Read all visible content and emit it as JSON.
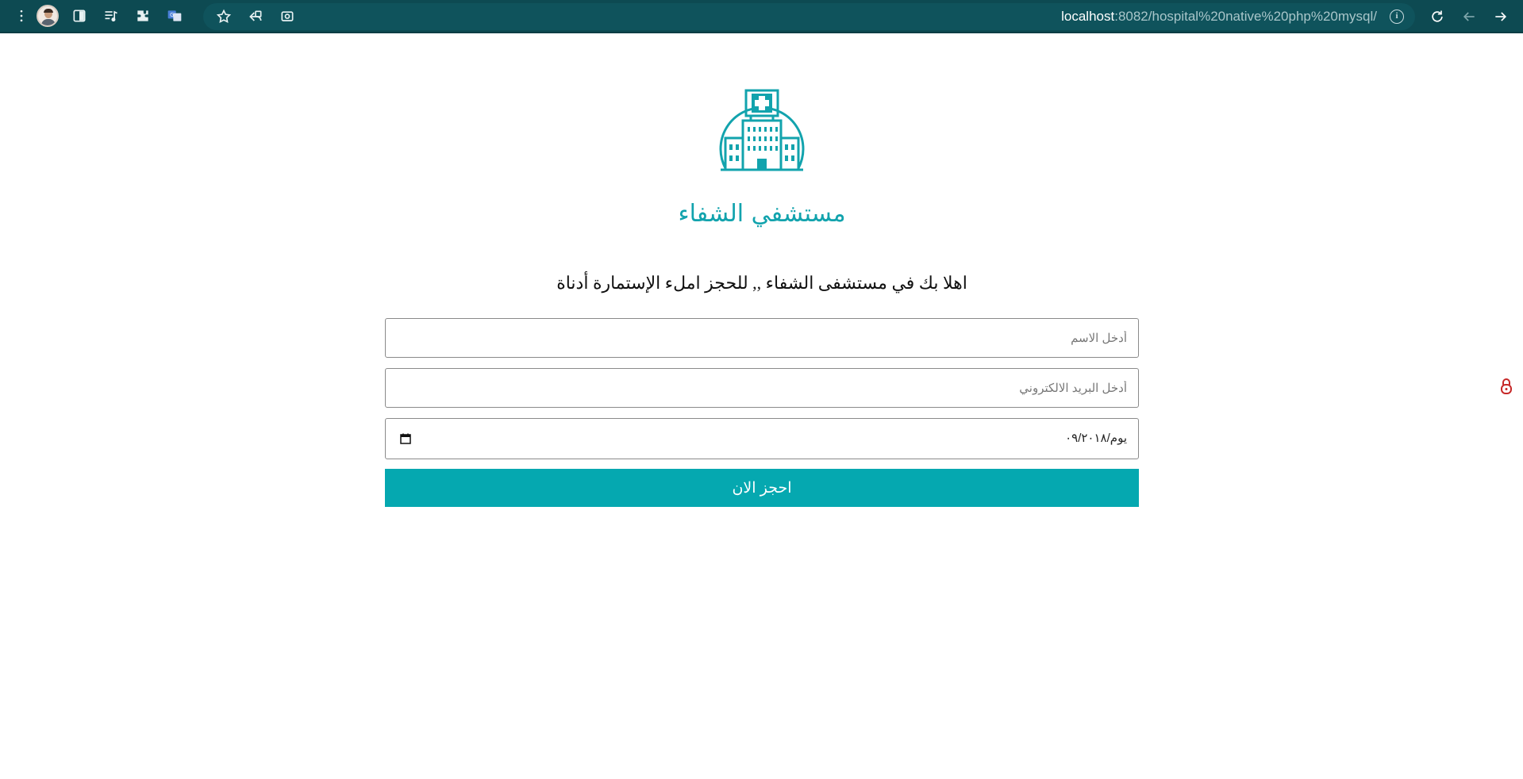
{
  "browser": {
    "url_host": "localhost",
    "url_rest": ":8082/hospital%20native%20php%20mysql/",
    "icons": [
      "menu-dots-icon",
      "profile-avatar",
      "sidebar-icon",
      "media-list-icon",
      "extensions-icon",
      "translate-icon",
      "star-icon",
      "share-icon",
      "screenshot-icon",
      "info-icon",
      "reload-icon",
      "back-icon",
      "forward-icon"
    ]
  },
  "page": {
    "brand_title": "مستشفي الشفاء",
    "welcome_text": "اهلا بك في مستشفى الشفاء ,, للحجز املء الإستمارة أدناة",
    "form": {
      "name_placeholder": "أدخل الاسم",
      "email_placeholder": "أدخل البريد الالكتروني",
      "date_value": "يوم/٠٩/٢٠١٨",
      "submit_label": "احجز الان"
    },
    "colors": {
      "accent": "#05a8b0",
      "brand_text": "#12a3ad",
      "toolbar": "#0d4a52"
    }
  }
}
